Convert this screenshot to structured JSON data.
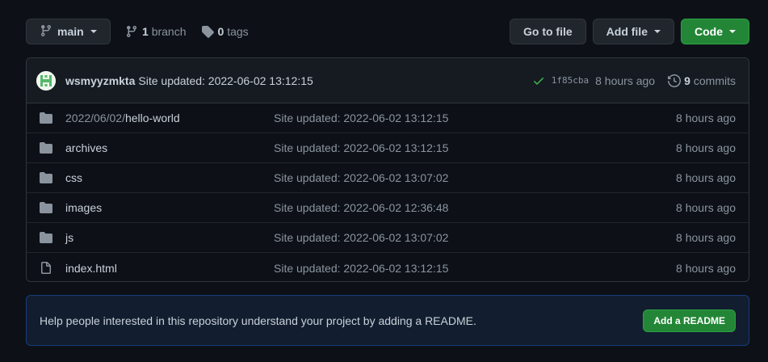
{
  "topbar": {
    "branch_name": "main",
    "branch_count": "1",
    "branch_word": "branch",
    "tag_count": "0",
    "tag_word": "tags",
    "go_to_file": "Go to file",
    "add_file": "Add file",
    "code": "Code"
  },
  "commit": {
    "author": "wsmyyzmkta",
    "message": "Site updated: 2022-06-02 13:12:15",
    "sha": "1f85cba",
    "ago": "8 hours ago",
    "commit_count": "9",
    "commit_word": "commits"
  },
  "files": [
    {
      "prefix": "2022/06/02/",
      "name": "hello-world",
      "message": "Site updated: 2022-06-02 13:12:15",
      "age": "8 hours ago",
      "icon": "folder-icon"
    },
    {
      "prefix": "",
      "name": "archives",
      "message": "Site updated: 2022-06-02 13:12:15",
      "age": "8 hours ago",
      "icon": "folder-icon"
    },
    {
      "prefix": "",
      "name": "css",
      "message": "Site updated: 2022-06-02 13:07:02",
      "age": "8 hours ago",
      "icon": "folder-icon"
    },
    {
      "prefix": "",
      "name": "images",
      "message": "Site updated: 2022-06-02 12:36:48",
      "age": "8 hours ago",
      "icon": "folder-icon"
    },
    {
      "prefix": "",
      "name": "js",
      "message": "Site updated: 2022-06-02 13:07:02",
      "age": "8 hours ago",
      "icon": "folder-icon"
    },
    {
      "prefix": "",
      "name": "index.html",
      "message": "Site updated: 2022-06-02 13:12:15",
      "age": "8 hours ago",
      "icon": "file-icon"
    }
  ],
  "readme": {
    "text": "Help people interested in this repository understand your project by adding a README.",
    "button": "Add a README"
  },
  "colors": {
    "background": "#0d1117",
    "border": "#30363d",
    "primary_button": "#238636",
    "success_check": "#3fb950"
  }
}
